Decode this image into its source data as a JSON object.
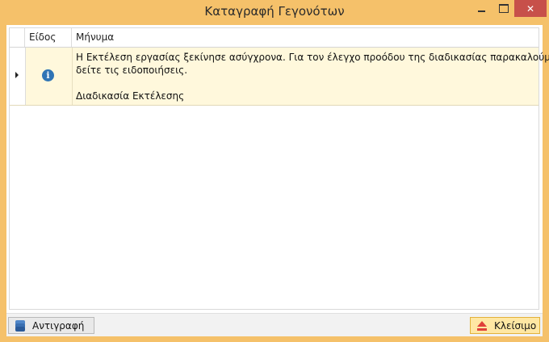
{
  "window": {
    "title": "Καταγραφή Γεγονότων",
    "accent_color": "#f5c16a",
    "close_color": "#c7504a",
    "controls": {
      "minimize": "minimize-icon",
      "maximize": "maximize-icon",
      "close": "close-icon",
      "close_glyph": "✕"
    }
  },
  "grid": {
    "columns": [
      "Είδος",
      "Μήνυμα"
    ],
    "rows": [
      {
        "type_icon": "info-icon",
        "type_glyph": "i",
        "message_line1": "Η Εκτέλεση εργασίας ξεκίνησε ασύγχρονα. Για τον έλεγχο προόδου  της διαδικασίας παρακαλούμε",
        "message_line2": "δείτε τις ειδοποιήσεις.",
        "message_line3": "",
        "message_line4": "Διαδικασία Εκτέλεσης"
      }
    ]
  },
  "footer": {
    "copy_label": "Αντιγραφή",
    "close_label": "Κλείσιμο"
  }
}
